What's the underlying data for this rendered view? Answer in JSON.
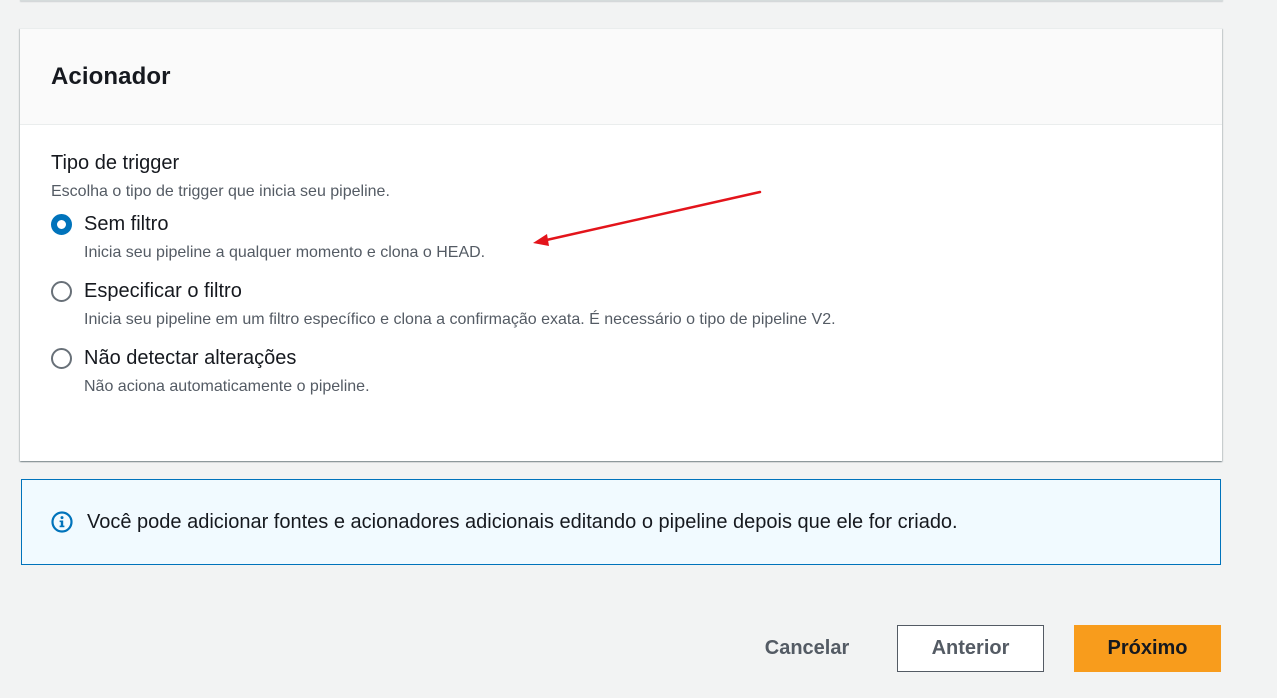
{
  "section": {
    "title": "Acionador"
  },
  "trigger": {
    "label": "Tipo de trigger",
    "description": "Escolha o tipo de trigger que inicia seu pipeline.",
    "options": [
      {
        "label": "Sem filtro",
        "description": "Inicia seu pipeline a qualquer momento e clona o HEAD.",
        "selected": true
      },
      {
        "label": "Especificar o filtro",
        "description": "Inicia seu pipeline em um filtro específico e clona a confirmação exata. É necessário o tipo de pipeline V2.",
        "selected": false
      },
      {
        "label": "Não detectar alterações",
        "description": "Não aciona automaticamente o pipeline.",
        "selected": false
      }
    ]
  },
  "info": {
    "icon": "info-icon",
    "text": "Você pode adicionar fontes e acionadores adicionais editando o pipeline depois que ele for criado."
  },
  "actions": {
    "cancel_label": "Cancelar",
    "previous_label": "Anterior",
    "next_label": "Próximo"
  },
  "colors": {
    "accent": "#0073bb",
    "primary_button": "#f89c1c",
    "annotation_arrow": "#e3141b",
    "info_background": "#f1faff"
  }
}
